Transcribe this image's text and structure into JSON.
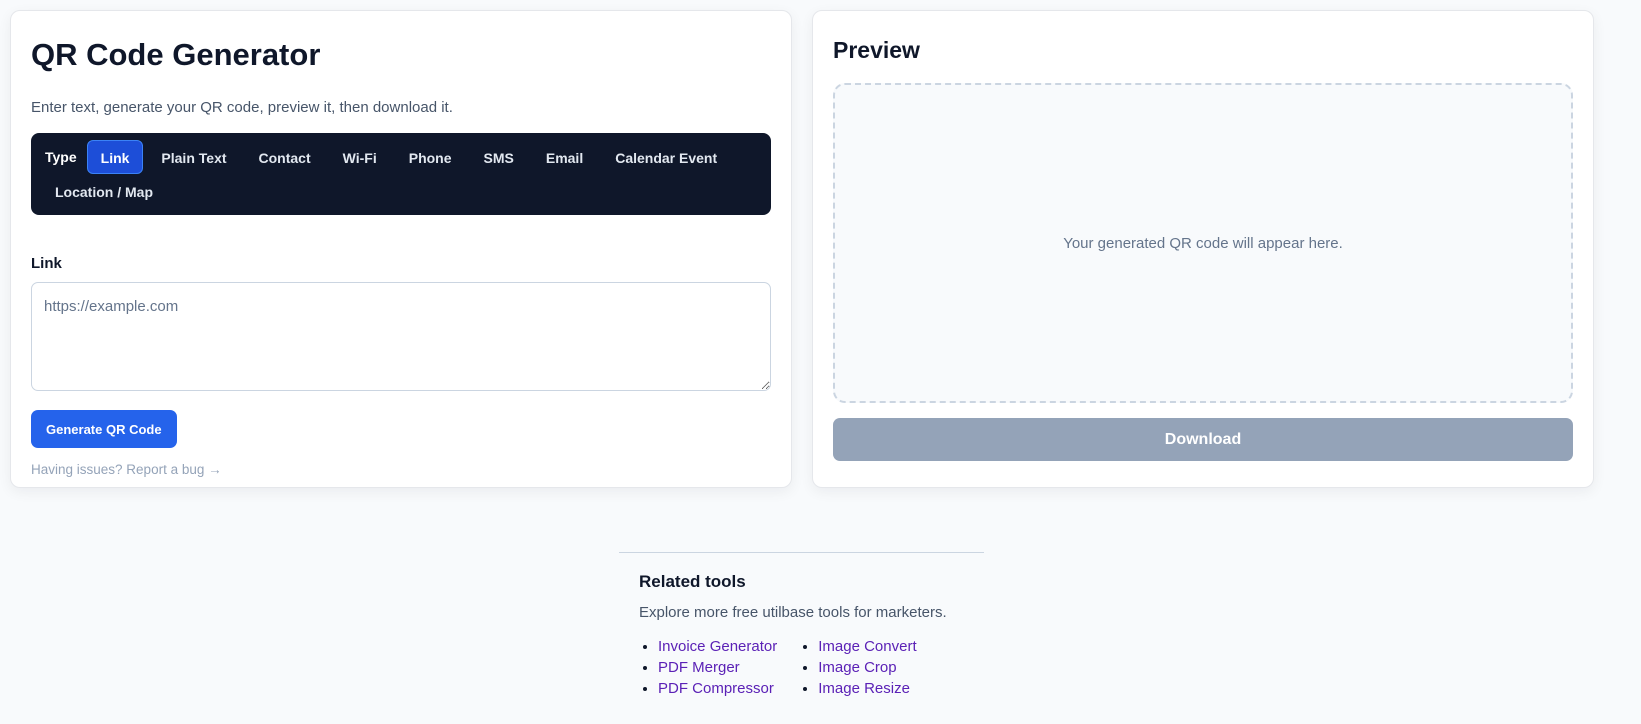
{
  "generator": {
    "title": "QR Code Generator",
    "subtitle": "Enter text, generate your QR code, preview it, then download it.",
    "type_label": "Type",
    "types": [
      "Link",
      "Plain Text",
      "Contact",
      "Wi-Fi",
      "Phone",
      "SMS",
      "Email",
      "Calendar Event",
      "Location / Map"
    ],
    "selected_type": "Link",
    "field_label": "Link",
    "field_placeholder": "https://example.com",
    "field_value": "",
    "generate_label": "Generate QR Code",
    "bug_link": "Having issues? Report a bug →"
  },
  "preview": {
    "title": "Preview",
    "placeholder": "Your generated QR code will appear here.",
    "download_label": "Download"
  },
  "related": {
    "title": "Related tools",
    "description": "Explore more free utilbase tools for marketers.",
    "links_col1": [
      "Invoice Generator",
      "PDF Merger",
      "PDF Compressor"
    ],
    "links_col2": [
      "Image Convert",
      "Image Crop",
      "Image Resize"
    ]
  },
  "colors": {
    "primary": "#2563eb",
    "active_tab": "#1d4ed8",
    "type_bar_bg": "#0f172a",
    "download_disabled": "#94a3b8",
    "related_link": "#5b21b6"
  }
}
